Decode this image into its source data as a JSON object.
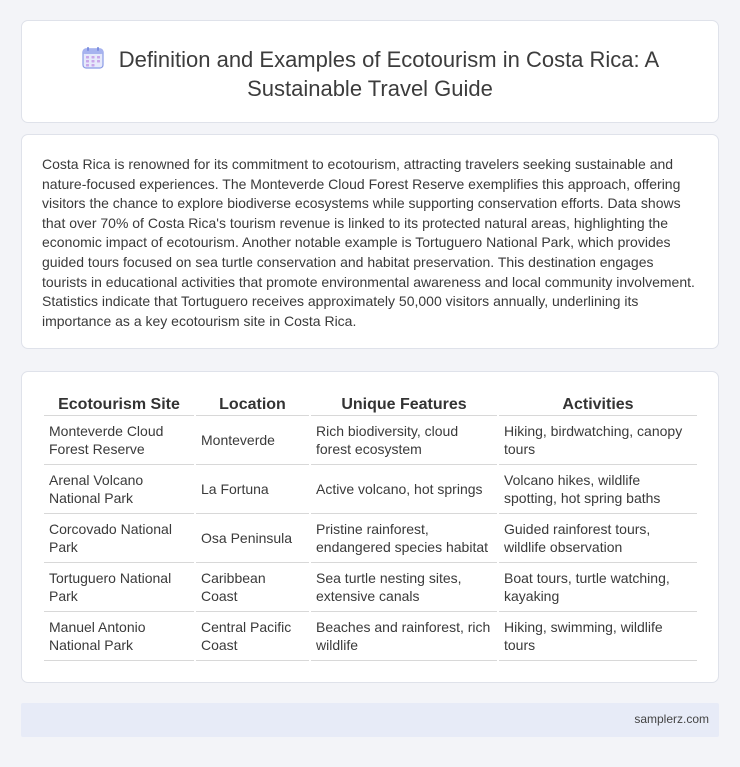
{
  "header": {
    "title": "Definition and Examples of Ecotourism in Costa Rica: A Sustainable Travel Guide",
    "icon": "calendar-icon"
  },
  "intro": {
    "text": "Costa Rica is renowned for its commitment to ecotourism, attracting travelers seeking sustainable and nature-focused experiences. The Monteverde Cloud Forest Reserve exemplifies this approach, offering visitors the chance to explore biodiverse ecosystems while supporting conservation efforts. Data shows that over 70% of Costa Rica's tourism revenue is linked to its protected natural areas, highlighting the economic impact of ecotourism. Another notable example is Tortuguero National Park, which provides guided tours focused on sea turtle conservation and habitat preservation. This destination engages tourists in educational activities that promote environmental awareness and local community involvement. Statistics indicate that Tortuguero receives approximately 50,000 visitors annually, underlining its importance as a key ecotourism site in Costa Rica."
  },
  "table": {
    "headers": [
      "Ecotourism Site",
      "Location",
      "Unique Features",
      "Activities"
    ],
    "rows": [
      [
        "Monteverde Cloud Forest Reserve",
        "Monteverde",
        "Rich biodiversity, cloud forest ecosystem",
        "Hiking, birdwatching, canopy tours"
      ],
      [
        "Arenal Volcano National Park",
        "La Fortuna",
        "Active volcano, hot springs",
        "Volcano hikes, wildlife spotting, hot spring baths"
      ],
      [
        "Corcovado National Park",
        "Osa Peninsula",
        "Pristine rainforest, endangered species habitat",
        "Guided rainforest tours, wildlife observation"
      ],
      [
        "Tortuguero National Park",
        "Caribbean Coast",
        "Sea turtle nesting sites, extensive canals",
        "Boat tours, turtle watching, kayaking"
      ],
      [
        "Manuel Antonio National Park",
        "Central Pacific Coast",
        "Beaches and rainforest, rich wildlife",
        "Hiking, swimming, wildlife tours"
      ]
    ]
  },
  "footer": {
    "site": "samplerz.com"
  },
  "colors": {
    "background": "#f3f4f8",
    "card": "#ffffff",
    "footer": "#e7ebf7",
    "icon_accent": "#7b8ee0"
  }
}
